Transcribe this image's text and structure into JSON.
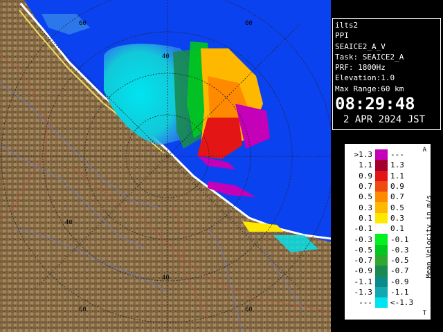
{
  "info": {
    "station": "ilts2",
    "mode": "PPI",
    "product": "SEAICE2_A_V",
    "task": "Task: SEAICE2_A",
    "prf": "PRF: 1800Hz",
    "elevation": "Elevation:1.0",
    "max_range": "Max Range:60 km",
    "time": "08:29:48",
    "date": "2 APR 2024 JST"
  },
  "map": {
    "ring_labels": [
      "60",
      "60",
      "40",
      "40",
      "40",
      "60",
      "60"
    ],
    "colors": {
      "sea": "#0b42f0",
      "land": "#8a6e48",
      "ring": "#222222"
    }
  },
  "legend": {
    "title": "Mean Velocity in m/s",
    "corner_top": "A",
    "corner_bottom": "T",
    "rows": [
      {
        "low": ">1.3",
        "high": "---",
        "color": "#c400b8"
      },
      {
        "low": "1.1",
        "high": "1.3",
        "color": "#a3002f"
      },
      {
        "low": "0.9",
        "high": "1.1",
        "color": "#e41515"
      },
      {
        "low": "0.7",
        "high": "0.9",
        "color": "#f04a10"
      },
      {
        "low": "0.5",
        "high": "0.7",
        "color": "#ff8a00"
      },
      {
        "low": "0.3",
        "high": "0.5",
        "color": "#ffb800"
      },
      {
        "low": "0.1",
        "high": "0.3",
        "color": "#ffe800"
      },
      {
        "low": "-0.1",
        "high": "0.1",
        "color": "#ffffff"
      },
      {
        "low": "-0.3",
        "high": "-0.1",
        "color": "#00f020"
      },
      {
        "low": "-0.5",
        "high": "-0.3",
        "color": "#00c81e"
      },
      {
        "low": "-0.7",
        "high": "-0.5",
        "color": "#30a830"
      },
      {
        "low": "-0.9",
        "high": "-0.7",
        "color": "#1a8a50"
      },
      {
        "low": "-1.1",
        "high": "-0.9",
        "color": "#0a8a8a"
      },
      {
        "low": "-1.3",
        "high": "-1.1",
        "color": "#12a8b0"
      },
      {
        "low": "---",
        "high": "<-1.3",
        "color": "#00e4f0"
      }
    ]
  }
}
